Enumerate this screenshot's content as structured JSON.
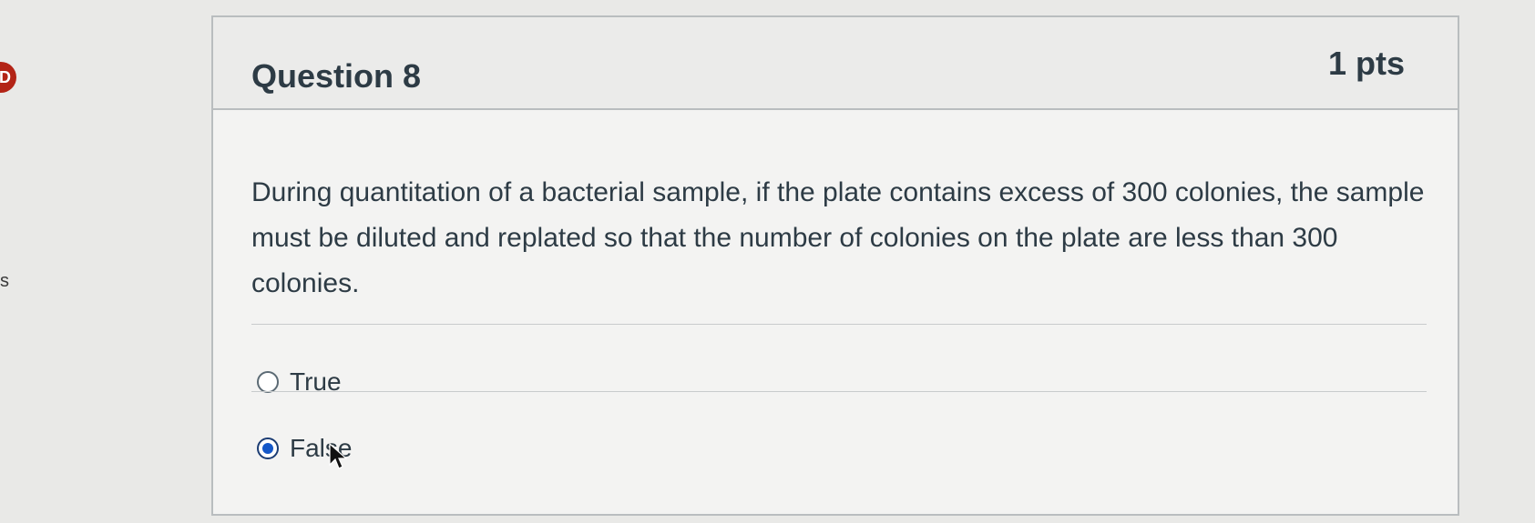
{
  "question": {
    "title": "Question 8",
    "points": "1 pts",
    "text": "During quantitation of a bacterial sample, if the plate contains excess of 300 colonies, the sample must be diluted and replated so that the number of colonies on the plate are less than 300 colonies."
  },
  "answers": [
    {
      "label": "True",
      "selected": false
    },
    {
      "label": "False",
      "selected": true
    }
  ],
  "left_edge": {
    "badge": "D",
    "letter": "s"
  },
  "colors": {
    "selected_radio": "#1457c8",
    "border": "#b9bdbf",
    "text": "#2d3b45"
  }
}
